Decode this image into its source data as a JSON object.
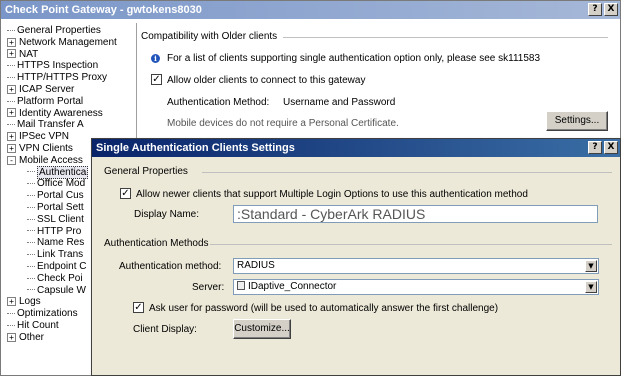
{
  "back_window": {
    "title": "Check Point Gateway - gwtokens8030",
    "title_buttons": [
      "?",
      "X"
    ]
  },
  "tree": {
    "items": [
      {
        "label": "General Properties",
        "expander": ""
      },
      {
        "label": "Network Management",
        "expander": "+"
      },
      {
        "label": "NAT",
        "expander": "+"
      },
      {
        "label": "HTTPS Inspection",
        "expander": ""
      },
      {
        "label": "HTTP/HTTPS Proxy",
        "expander": ""
      },
      {
        "label": "ICAP Server",
        "expander": "+"
      },
      {
        "label": "Platform Portal",
        "expander": ""
      },
      {
        "label": "Identity Awareness",
        "expander": "+"
      },
      {
        "label": "Mail Transfer A",
        "expander": ""
      },
      {
        "label": "IPSec VPN",
        "expander": "+"
      },
      {
        "label": "VPN Clients",
        "expander": "+"
      },
      {
        "label": "Mobile Access",
        "expander": "-"
      },
      {
        "label": "Authentica",
        "expander": ""
      },
      {
        "label": "Office Mod",
        "expander": ""
      },
      {
        "label": "Portal Cus",
        "expander": ""
      },
      {
        "label": "Portal Sett",
        "expander": ""
      },
      {
        "label": "SSL Client",
        "expander": ""
      },
      {
        "label": "HTTP Pro",
        "expander": ""
      },
      {
        "label": "Name Res",
        "expander": ""
      },
      {
        "label": "Link Trans",
        "expander": ""
      },
      {
        "label": "Endpoint C",
        "expander": ""
      },
      {
        "label": "Check Poi",
        "expander": ""
      },
      {
        "label": "Capsule W",
        "expander": ""
      },
      {
        "label": "Logs",
        "expander": "+"
      },
      {
        "label": "Optimizations",
        "expander": ""
      },
      {
        "label": "Hit Count",
        "expander": ""
      },
      {
        "label": "Other",
        "expander": "+"
      }
    ]
  },
  "back_content": {
    "compat_header": "Compatibility with Older clients",
    "info_text": "For a list of clients supporting single authentication option only, please see sk111583",
    "allow_older_label": "Allow older clients to connect to this gateway",
    "allow_older_checked": "✓",
    "auth_method_label": "Authentication Method:",
    "auth_method_value": "Username and Password",
    "mobile_note": "Mobile devices do not require a Personal Certificate.",
    "settings_button": "Settings..."
  },
  "dialog": {
    "title": "Single Authentication Clients Settings",
    "title_buttons": [
      "?",
      "X"
    ],
    "general_header": "General Properties",
    "allow_newer_label": "Allow newer clients that support Multiple Login Options to use this authentication method",
    "allow_newer_checked": "✓",
    "display_name_label": "Display Name:",
    "display_name_value": ":Standard - CyberArk RADIUS",
    "auth_methods_header": "Authentication Methods",
    "auth_method_label": "Authentication method:",
    "auth_method_value": "RADIUS",
    "server_label": "Server:",
    "server_value": "IDaptive_Connector",
    "ask_password_label": "Ask user for password (will be used to automatically answer the first challenge)",
    "ask_password_checked": "✓",
    "client_display_label": "Client Display:",
    "customize_button": "Customize..."
  },
  "colors": {
    "active_title": "#0a246a",
    "inactive_title": "#7a96c8",
    "info_icon": "#2255bb"
  }
}
